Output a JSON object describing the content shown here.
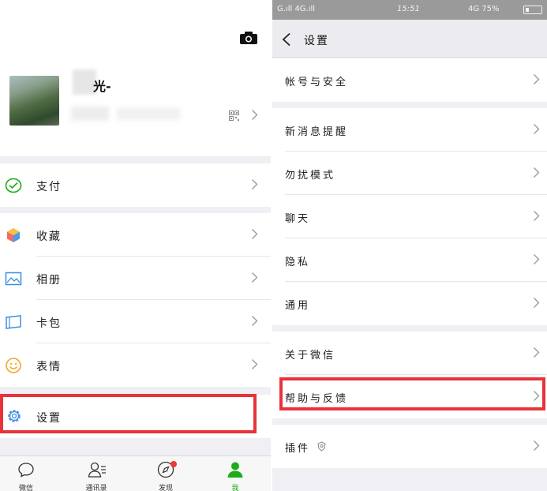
{
  "left": {
    "profile": {
      "name_visible": "光-"
    },
    "menu_group1": [
      {
        "label": "支付",
        "icon": "wallet-icon"
      }
    ],
    "menu_group2": [
      {
        "label": "收藏",
        "icon": "favorites-cube-icon"
      },
      {
        "label": "相册",
        "icon": "album-icon"
      },
      {
        "label": "卡包",
        "icon": "card-pack-icon"
      },
      {
        "label": "表情",
        "icon": "sticker-smile-icon"
      }
    ],
    "menu_group3": [
      {
        "label": "设置",
        "icon": "gear-icon"
      }
    ],
    "tabs": [
      {
        "label": "微信",
        "icon": "chat-bubble-icon",
        "active": false
      },
      {
        "label": "通讯录",
        "icon": "contacts-icon",
        "active": false
      },
      {
        "label": "发现",
        "icon": "compass-icon",
        "active": false,
        "badge": true
      },
      {
        "label": "我",
        "icon": "person-icon",
        "active": true
      }
    ],
    "accent_color": "#1aad19",
    "highlight_color": "#e8333a"
  },
  "right": {
    "status": {
      "left": "G.ıll 4G.ıll",
      "time": "15:51",
      "right": "4G 75%"
    },
    "title": "设置",
    "group1": [
      {
        "label": "帐号与安全"
      }
    ],
    "group2": [
      {
        "label": "新消息提醒"
      },
      {
        "label": "勿扰模式"
      },
      {
        "label": "聊天"
      },
      {
        "label": "隐私"
      },
      {
        "label": "通用"
      }
    ],
    "group3": [
      {
        "label": "关于微信"
      },
      {
        "label": "帮助与反馈"
      }
    ],
    "group4": [
      {
        "label": "插件"
      }
    ]
  }
}
